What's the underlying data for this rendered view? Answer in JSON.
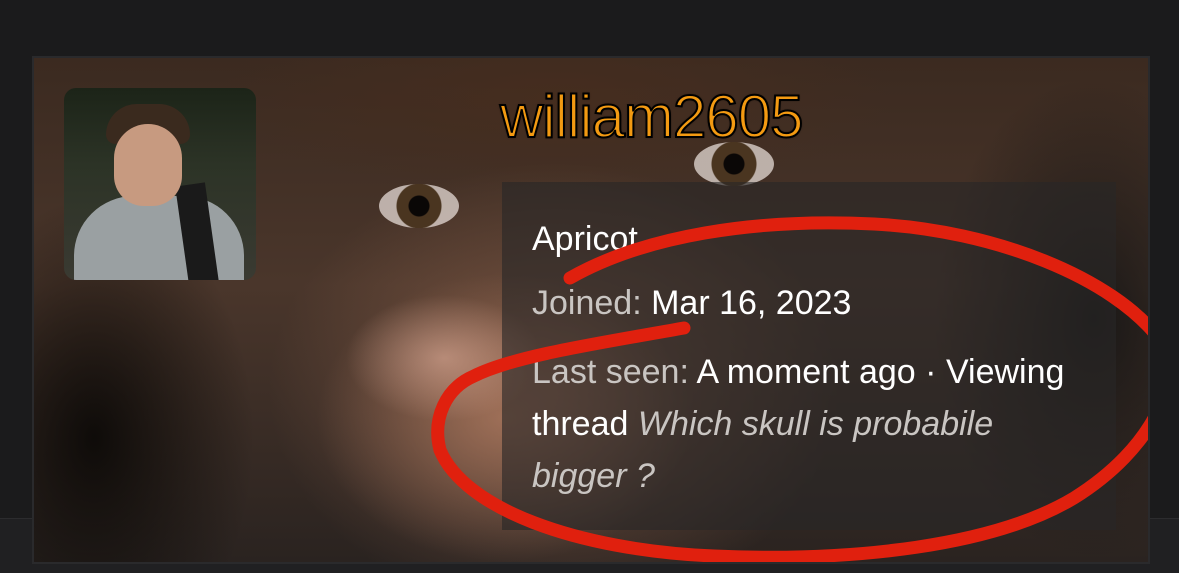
{
  "profile": {
    "username": "william2605",
    "rank": "Apricot",
    "joined_label": "Joined:",
    "joined_date": "Mar 16, 2023",
    "last_seen_label": "Last seen:",
    "last_seen_value": "A moment ago",
    "separator": "·",
    "activity_label": "Viewing thread",
    "activity_thread": "Which skull is probabile bigger ?"
  },
  "colors": {
    "username": "#f39a12",
    "annotation": "#e0200e",
    "panel": "#282626"
  }
}
